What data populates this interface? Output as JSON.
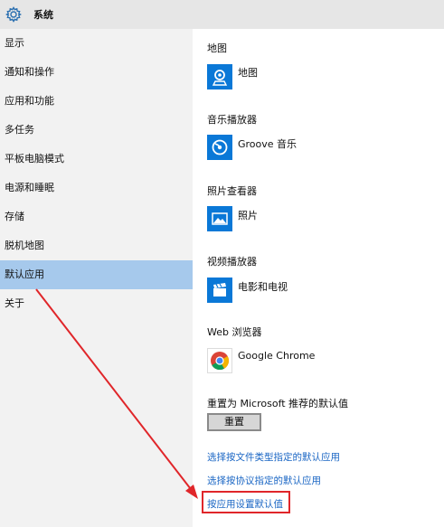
{
  "window": {
    "title": "系统",
    "icon": "gear-icon"
  },
  "sidebar": {
    "items": [
      {
        "label": "显示",
        "selected": false
      },
      {
        "label": "通知和操作",
        "selected": false
      },
      {
        "label": "应用和功能",
        "selected": false
      },
      {
        "label": "多任务",
        "selected": false
      },
      {
        "label": "平板电脑模式",
        "selected": false
      },
      {
        "label": "电源和睡眠",
        "selected": false
      },
      {
        "label": "存储",
        "selected": false
      },
      {
        "label": "脱机地图",
        "selected": false
      },
      {
        "label": "默认应用",
        "selected": true
      },
      {
        "label": "关于",
        "selected": false
      }
    ],
    "selected_color": "#a6c9ec"
  },
  "main": {
    "sections": [
      {
        "heading": "地图",
        "app": "地图",
        "icon": "maps-icon"
      },
      {
        "heading": "音乐播放器",
        "app": "Groove 音乐",
        "icon": "groove-music-icon"
      },
      {
        "heading": "照片查看器",
        "app": "照片",
        "icon": "photos-icon"
      },
      {
        "heading": "视频播放器",
        "app": "电影和电视",
        "icon": "movies-tv-icon"
      },
      {
        "heading": "Web 浏览器",
        "app": "Google Chrome",
        "icon": "chrome-icon"
      }
    ],
    "reset": {
      "label": "重置为 Microsoft 推荐的默认值",
      "button": "重置"
    },
    "links": [
      "选择按文件类型指定的默认应用",
      "选择按协议指定的默认应用",
      "按应用设置默认值"
    ]
  },
  "colors": {
    "accent": "#0a78d7",
    "link": "#1a66c4",
    "annotation": "#e0262a"
  }
}
